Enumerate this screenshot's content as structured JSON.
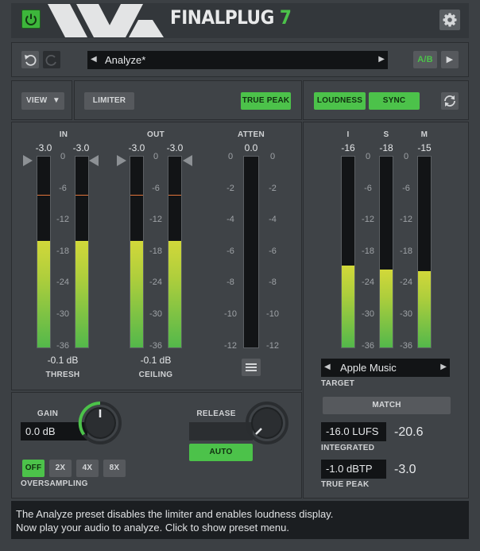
{
  "header": {
    "title": "FINALPLUG",
    "version": "7",
    "power_icon": "power-icon",
    "settings_icon": "gear-icon"
  },
  "toolbar": {
    "preset_name": "Analyze*",
    "ab_label": "A/B",
    "undo_icon": "undo-icon",
    "redo_icon": "redo-icon"
  },
  "controls": {
    "view_label": "VIEW",
    "limiter_label": "LIMITER",
    "true_peak_label": "TRUE PEAK",
    "loudness_label": "LOUDNESS",
    "sync_label": "SYNC"
  },
  "meters": {
    "in_label": "IN",
    "out_label": "OUT",
    "atten_label": "ATTEN",
    "in_values": [
      "-3.0",
      "-3.0"
    ],
    "out_values": [
      "-3.0",
      "-3.0"
    ],
    "atten_value": "0.0",
    "scale_left": [
      "0",
      "-6",
      "-12",
      "-18",
      "-24",
      "-30",
      "-36"
    ],
    "scale_atten": [
      "0",
      "-2",
      "-4",
      "-6",
      "-8",
      "-10",
      "-12"
    ],
    "in_level_fraction": 0.56,
    "out_level_fraction": 0.56,
    "thresh_value": "-0.1 dB",
    "thresh_label": "THRESH",
    "ceiling_value": "-0.1 dB",
    "ceiling_label": "CEILING"
  },
  "loudness": {
    "i_label": "I",
    "s_label": "S",
    "m_label": "M",
    "i_value": "-16",
    "s_value": "-18",
    "m_value": "-15",
    "scale": [
      "0",
      "-6",
      "-12",
      "-18",
      "-24",
      "-30",
      "-36"
    ],
    "i_level_fraction": 0.43,
    "s_level_fraction": 0.41,
    "m_level_fraction": 0.4,
    "target_value": "Apple Music",
    "target_label": "TARGET",
    "match_label": "MATCH",
    "integrated_target": "-16.0 LUFS",
    "integrated_value": "-20.6",
    "integrated_label": "INTEGRATED",
    "true_peak_target": "-1.0 dBTP",
    "true_peak_value": "-3.0",
    "true_peak_label": "TRUE PEAK"
  },
  "bottom": {
    "gain_label": "GAIN",
    "gain_value": "0.0 dB",
    "release_label": "RELEASE",
    "release_value": "",
    "auto_label": "AUTO",
    "oversampling_label": "OVERSAMPLING",
    "oversampling_options": [
      "OFF",
      "2X",
      "4X",
      "8X"
    ]
  },
  "status": {
    "line1": "The Analyze preset disables the limiter and enables loudness display.",
    "line2": "Now play your audio to analyze. Click to show preset menu."
  },
  "colors": {
    "accent_green": "#4cc24a",
    "panel_bg": "#3f4347",
    "meter_peak": "#e0743a"
  }
}
